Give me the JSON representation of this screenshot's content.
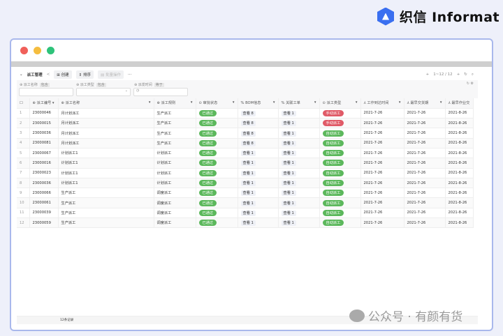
{
  "brand": {
    "name": "织信 Informat"
  },
  "watermark": "公众号 · 有颜有货",
  "window_dots": [
    "#f0605a",
    "#f5bd3f",
    "#2ec37a"
  ],
  "toolbar": {
    "title": "派工管理",
    "create": "创建",
    "sort": "排序",
    "batch": "批量操作",
    "more": "···",
    "pagination": "1~12 / 12"
  },
  "filters": [
    {
      "label": "派工名称",
      "op": "包含"
    },
    {
      "label": "派工类型",
      "op": "包含"
    },
    {
      "label": "派发时间",
      "op": "等于"
    }
  ],
  "columns": [
    "派工编号",
    "派工名称",
    "派工规则",
    "审批状态",
    "BOM信息",
    "关联工单",
    "派工类型",
    "工作到达时间",
    "最早交货期",
    "最早作业交"
  ],
  "colors": {
    "approved": "#5cb85c",
    "manual": "#e05a67",
    "auto": "#5cb85c"
  },
  "rows": [
    {
      "n": "1",
      "id": "23000046",
      "name": "月计划派工",
      "rule": "生产派工",
      "status": "已通过",
      "bom": "查看 8",
      "link": "查看 1",
      "type": "手动派工",
      "t1": "2021-7-26",
      "t2": "2021-7-26",
      "t3": "2021-8-26"
    },
    {
      "n": "2",
      "id": "23000015",
      "name": "月计划派工",
      "rule": "生产派工",
      "status": "已通过",
      "bom": "查看 8",
      "link": "查看 1",
      "type": "手动派工",
      "t1": "2021-7-26",
      "t2": "2021-7-26",
      "t3": "2021-8-26"
    },
    {
      "n": "3",
      "id": "23000036",
      "name": "月计划派工",
      "rule": "生产派工",
      "status": "已通过",
      "bom": "查看 8",
      "link": "查看 1",
      "type": "自动派工",
      "t1": "2021-7-26",
      "t2": "2021-7-26",
      "t3": "2021-8-26"
    },
    {
      "n": "4",
      "id": "23000081",
      "name": "月计划派工",
      "rule": "生产派工",
      "status": "已通过",
      "bom": "查看 8",
      "link": "查看 1",
      "type": "自动派工",
      "t1": "2021-7-26",
      "t2": "2021-7-26",
      "t3": "2021-8-26"
    },
    {
      "n": "5",
      "id": "23000067",
      "name": "计划派工1",
      "rule": "计划派工",
      "status": "已通过",
      "bom": "查看 1",
      "link": "查看 1",
      "type": "自动派工",
      "t1": "2021-7-26",
      "t2": "2021-7-26",
      "t3": "2021-8-26"
    },
    {
      "n": "6",
      "id": "23000016",
      "name": "计划派工1",
      "rule": "计划派工",
      "status": "已通过",
      "bom": "查看 1",
      "link": "查看 1",
      "type": "自动派工",
      "t1": "2021-7-26",
      "t2": "2021-7-26",
      "t3": "2021-8-26"
    },
    {
      "n": "7",
      "id": "23000023",
      "name": "计划派工1",
      "rule": "计划派工",
      "status": "已通过",
      "bom": "查看 1",
      "link": "查看 1",
      "type": "自动派工",
      "t1": "2021-7-26",
      "t2": "2021-7-26",
      "t3": "2021-8-26"
    },
    {
      "n": "8",
      "id": "23000036",
      "name": "计划派工1",
      "rule": "计划派工",
      "status": "已通过",
      "bom": "查看 1",
      "link": "查看 1",
      "type": "自动派工",
      "t1": "2021-7-26",
      "t2": "2021-7-26",
      "t3": "2021-8-26"
    },
    {
      "n": "9",
      "id": "23000066",
      "name": "生产派工",
      "rule": "调度派工",
      "status": "已通过",
      "bom": "查看 1",
      "link": "查看 1",
      "type": "自动派工",
      "t1": "2021-7-26",
      "t2": "2021-7-26",
      "t3": "2021-8-26"
    },
    {
      "n": "10",
      "id": "23000061",
      "name": "生产派工",
      "rule": "调度派工",
      "status": "已通过",
      "bom": "查看 1",
      "link": "查看 1",
      "type": "自动派工",
      "t1": "2021-7-26",
      "t2": "2021-7-26",
      "t3": "2021-8-26"
    },
    {
      "n": "11",
      "id": "23000039",
      "name": "生产派工",
      "rule": "调度派工",
      "status": "已通过",
      "bom": "查看 1",
      "link": "查看 1",
      "type": "自动派工",
      "t1": "2021-7-26",
      "t2": "2021-7-26",
      "t3": "2021-8-26"
    },
    {
      "n": "12",
      "id": "23000059",
      "name": "生产派工",
      "rule": "调度派工",
      "status": "已通过",
      "bom": "查看 1",
      "link": "查看 1",
      "type": "自动派工",
      "t1": "2021-7-26",
      "t2": "2021-7-26",
      "t3": "2021-8-26"
    }
  ],
  "footer": {
    "count": "12条记录"
  }
}
